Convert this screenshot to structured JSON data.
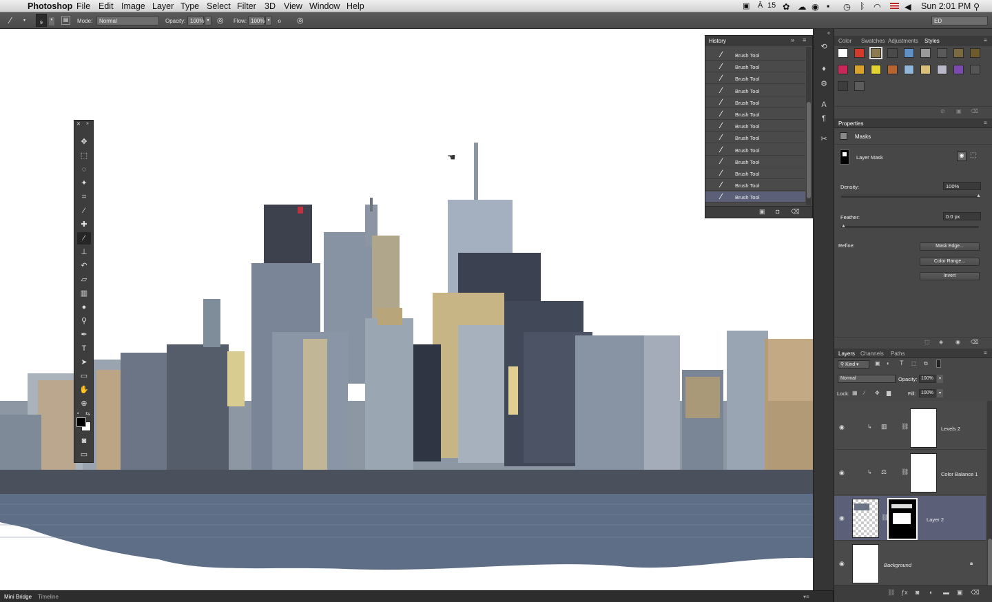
{
  "menubar": {
    "apple": "",
    "app_name": "Photoshop",
    "items": [
      "File",
      "Edit",
      "Image",
      "Layer",
      "Type",
      "Select",
      "Filter",
      "3D",
      "View",
      "Window",
      "Help"
    ],
    "status": {
      "adobe_count": "15",
      "clock": "Sun 2:01 PM"
    }
  },
  "options": {
    "brush_size": "9",
    "mode_label": "Mode:",
    "mode_value": "Normal",
    "opacity_label": "Opacity:",
    "opacity_value": "100%",
    "flow_label": "Flow:",
    "flow_value": "100%",
    "workspace": "ED"
  },
  "history": {
    "title": "History",
    "items": [
      "Brush Tool",
      "Brush Tool",
      "Brush Tool",
      "Brush Tool",
      "Brush Tool",
      "Brush Tool",
      "Brush Tool",
      "Brush Tool",
      "Brush Tool",
      "Brush Tool",
      "Brush Tool",
      "Brush Tool",
      "Brush Tool"
    ]
  },
  "styles_panel": {
    "tabs": [
      "Color",
      "Swatches",
      "Adjustments",
      "Styles"
    ],
    "active": "Styles"
  },
  "properties": {
    "title": "Properties",
    "section": "Masks",
    "mask_label": "Layer Mask",
    "density_label": "Density:",
    "density_value": "100%",
    "density_fraction": 1.0,
    "feather_label": "Feather:",
    "feather_value": "0.0 px",
    "feather_fraction": 0.0,
    "refine_label": "Refine:",
    "buttons": [
      "Mask Edge...",
      "Color Range...",
      "Invert"
    ]
  },
  "layers": {
    "tabs": [
      "Layers",
      "Channels",
      "Paths"
    ],
    "kind_label": "Kind",
    "blend_mode": "Normal",
    "opacity_label": "Opacity:",
    "opacity_value": "100%",
    "lock_label": "Lock:",
    "fill_label": "Fill:",
    "fill_value": "100%",
    "rows": [
      {
        "name": "Levels 2"
      },
      {
        "name": "Color Balance 1"
      },
      {
        "name": "Layer 2"
      },
      {
        "name": "Background"
      }
    ]
  },
  "bottom_tabs": [
    "Mini Bridge",
    "Timeline"
  ],
  "colors": {
    "ui_dark": "#474747",
    "selection": "#5b6078",
    "water": "#5d6e86",
    "sky": "#ffffff"
  }
}
